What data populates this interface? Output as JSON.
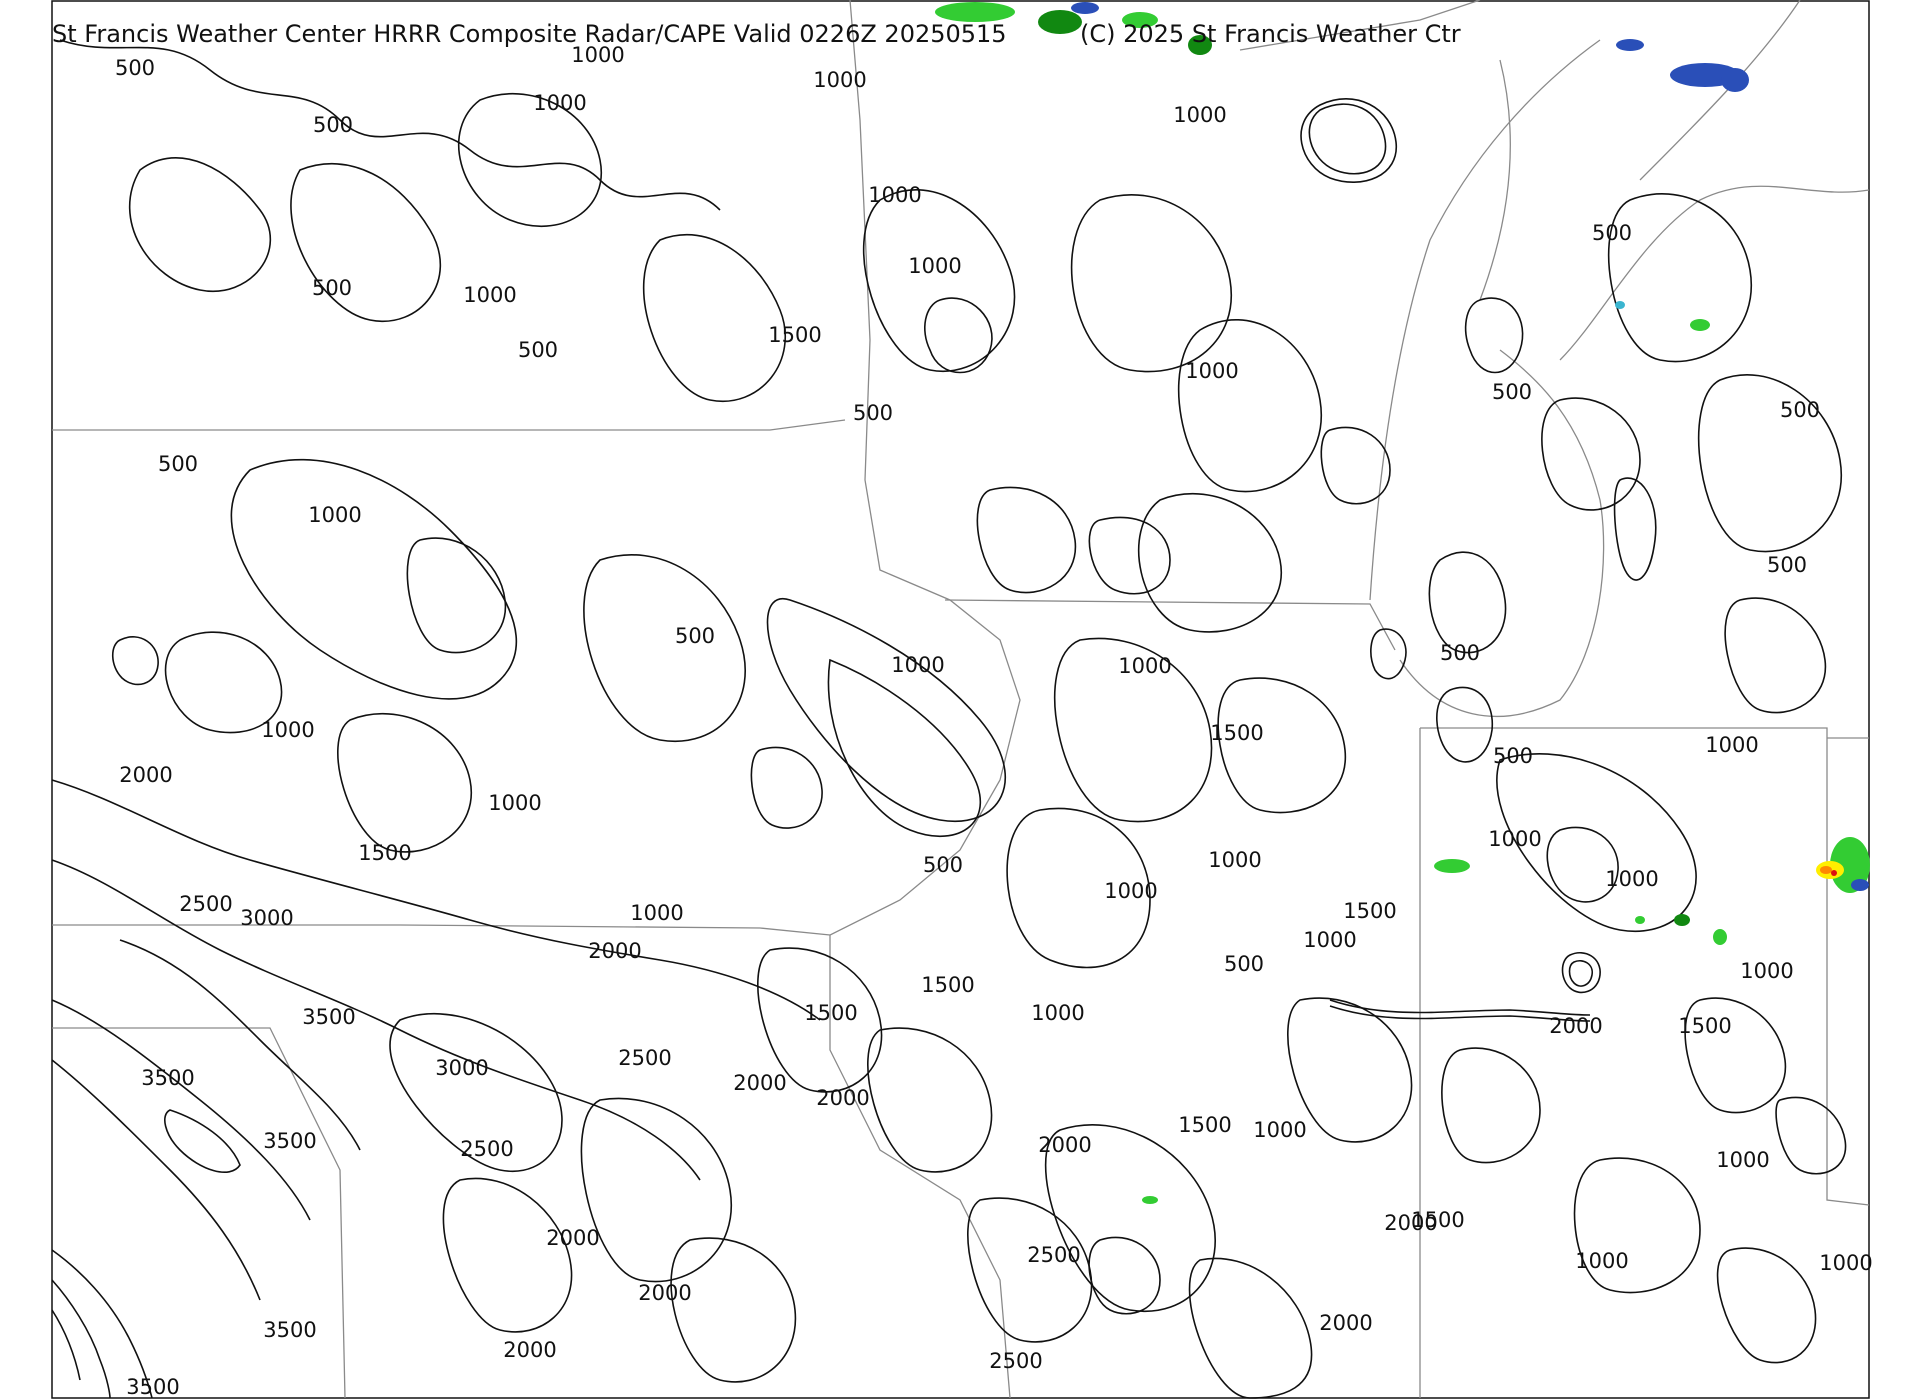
{
  "title": "St Francis Weather Center HRRR Composite Radar/CAPE  Valid  0226Z 20250515",
  "copyright": "(C) 2025 St Francis Weather Ctr",
  "colors": {
    "contour": "#111111",
    "border": "#8a8a8a",
    "radar_light_green": "#33cc33",
    "radar_dark_green": "#118811",
    "radar_blue": "#2a4fb8",
    "radar_cyan": "#3bb5d0",
    "radar_yellow": "#ffee00",
    "radar_orange": "#ff8800",
    "radar_red": "#dd1111"
  },
  "contour_labels": [
    "500",
    "1000",
    "500",
    "1000",
    "1000",
    "1000",
    "500",
    "1000",
    "500",
    "1000",
    "500",
    "1500",
    "1000",
    "500",
    "500",
    "1000",
    "500",
    "500",
    "500",
    "500",
    "1000",
    "1000",
    "500",
    "1000",
    "1000",
    "1500",
    "500",
    "1000",
    "2000",
    "1000",
    "1000",
    "1500",
    "500",
    "1000",
    "2500",
    "3000",
    "1000",
    "1000",
    "1500",
    "1000",
    "2000",
    "1000",
    "500",
    "1000",
    "1500",
    "3500",
    "1500",
    "1000",
    "2000",
    "3500",
    "3000",
    "2500",
    "2000",
    "2000",
    "1500",
    "1000",
    "1500",
    "3500",
    "2500",
    "2000",
    "1000",
    "2000",
    "2500",
    "1500",
    "1000",
    "2000",
    "2000",
    "1000",
    "3500",
    "2000",
    "2000",
    "2500",
    "3500"
  ]
}
